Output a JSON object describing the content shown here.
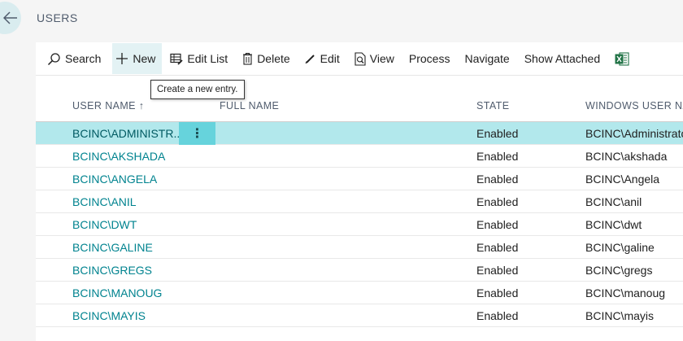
{
  "page": {
    "title": "USERS"
  },
  "toolbar": {
    "items": [
      {
        "label": "Search",
        "icon": "search-icon"
      },
      {
        "label": "New",
        "icon": "plus-icon"
      },
      {
        "label": "Edit List",
        "icon": "edit-list-icon"
      },
      {
        "label": "Delete",
        "icon": "trash-icon"
      },
      {
        "label": "Edit",
        "icon": "pencil-icon"
      },
      {
        "label": "View",
        "icon": "view-icon"
      },
      {
        "label": "Process",
        "icon": ""
      },
      {
        "label": "Navigate",
        "icon": ""
      },
      {
        "label": "Show Attached",
        "icon": ""
      },
      {
        "label": "",
        "icon": "excel-icon"
      }
    ],
    "tooltip": "Create a new entry."
  },
  "grid": {
    "columns": {
      "user_name": "USER NAME ↑",
      "full_name": "FULL NAME",
      "state": "STATE",
      "windows_user_name": "WINDOWS USER NA"
    },
    "row_menu_glyph": "⋮",
    "rows": [
      {
        "user_name": "BCINC\\ADMINISTR...",
        "full_name": "",
        "state": "Enabled",
        "windows_user_name": "BCINC\\Administrato"
      },
      {
        "user_name": "BCINC\\AKSHADA",
        "full_name": "",
        "state": "Enabled",
        "windows_user_name": "BCINC\\akshada"
      },
      {
        "user_name": "BCINC\\ANGELA",
        "full_name": "",
        "state": "Enabled",
        "windows_user_name": "BCINC\\Angela"
      },
      {
        "user_name": "BCINC\\ANIL",
        "full_name": "",
        "state": "Enabled",
        "windows_user_name": "BCINC\\anil"
      },
      {
        "user_name": "BCINC\\DWT",
        "full_name": "",
        "state": "Enabled",
        "windows_user_name": "BCINC\\dwt"
      },
      {
        "user_name": "BCINC\\GALINE",
        "full_name": "",
        "state": "Enabled",
        "windows_user_name": "BCINC\\galine"
      },
      {
        "user_name": "BCINC\\GREGS",
        "full_name": "",
        "state": "Enabled",
        "windows_user_name": "BCINC\\gregs"
      },
      {
        "user_name": "BCINC\\MANOUG",
        "full_name": "",
        "state": "Enabled",
        "windows_user_name": "BCINC\\manoug"
      },
      {
        "user_name": "BCINC\\MAYIS",
        "full_name": "",
        "state": "Enabled",
        "windows_user_name": "BCINC\\mayis"
      }
    ]
  },
  "colors": {
    "accent": "#00838f",
    "selected_row": "#b2e8ec",
    "row_menu": "#66d3dc",
    "excel": "#217346"
  }
}
